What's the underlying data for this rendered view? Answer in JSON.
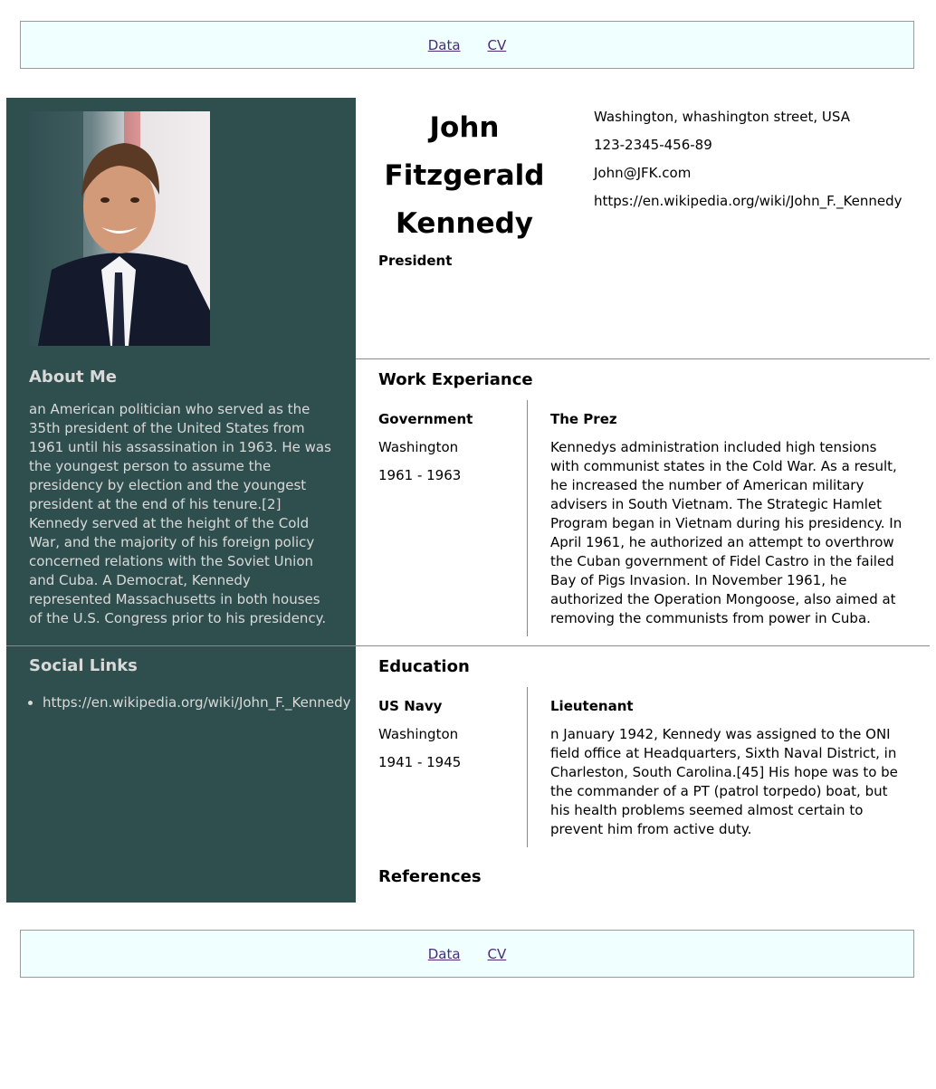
{
  "nav": {
    "data_link": "Data",
    "cv_link": "CV"
  },
  "sidebar": {
    "about_title": "About Me",
    "about_text": "an American politician who served as the 35th president of the United States from 1961 until his assassination in 1963. He was the youngest person to assume the presidency by election and the youngest president at the end of his tenure.[2] Kennedy served at the height of the Cold War, and the majority of his foreign policy concerned relations with the Soviet Union and Cuba. A Democrat, Kennedy represented Massachusetts in both houses of the U.S. Congress prior to his presidency.",
    "social_title": "Social Links",
    "social_links": [
      "https://en.wikipedia.org/wiki/John_F._Kennedy"
    ]
  },
  "header": {
    "name_line1": "John",
    "name_line2": "Fitzgerald",
    "name_line3": "Kennedy",
    "role": "President",
    "address": "Washington, whashington street, USA",
    "phone": "123-2345-456-89",
    "email": "John@JFK.com",
    "website": "https://en.wikipedia.org/wiki/John_F._Kennedy"
  },
  "work": {
    "title": "Work Experiance",
    "org": "Government",
    "location": "Washington",
    "dates": "1961 - 1963",
    "role": "The Prez",
    "description": "Kennedys administration included high tensions with communist states in the Cold War. As a result, he increased the number of American military advisers in South Vietnam. The Strategic Hamlet Program began in Vietnam during his presidency. In April 1961, he authorized an attempt to overthrow the Cuban government of Fidel Castro in the failed Bay of Pigs Invasion. In November 1961, he authorized the Operation Mongoose, also aimed at removing the communists from power in Cuba."
  },
  "education": {
    "title": "Education",
    "org": "US Navy",
    "location": "Washington",
    "dates": "1941 - 1945",
    "role": "Lieutenant",
    "description": "n January 1942, Kennedy was assigned to the ONI field office at Headquarters, Sixth Naval District, in Charleston, South Carolina.[45] His hope was to be the commander of a PT (patrol torpedo) boat, but his health problems seemed almost certain to prevent him from active duty."
  },
  "references": {
    "title": "References"
  }
}
